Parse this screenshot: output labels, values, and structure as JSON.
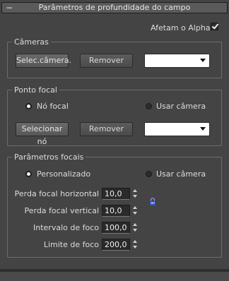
{
  "rollout": {
    "collapse_symbol": "−",
    "title": "Parâmetros de profundidade do campo"
  },
  "affect_alpha": {
    "label": "Afetam o Alpha",
    "checked": true
  },
  "cameras": {
    "title": "Câmeras",
    "select_button": "Selec.câmera.",
    "remove_button": "Remover",
    "dropdown_value": ""
  },
  "focal_point": {
    "title": "Ponto focal",
    "radio_focal_node": "Nó focal",
    "radio_use_camera": "Usar câmera",
    "selected": "focal_node",
    "select_node_button": "Selecionar nó",
    "remove_button": "Remover",
    "dropdown_value": ""
  },
  "focal_params": {
    "title": "Parâmetros focais",
    "radio_custom": "Personalizado",
    "radio_use_camera": "Usar câmera",
    "selected": "custom",
    "horizontal_loss_label": "Perda focal horizontal",
    "horizontal_loss_value": "10,0",
    "vertical_loss_label": "Perda focal vertical",
    "vertical_loss_value": "10,0",
    "focus_interval_label": "Intervalo de foco",
    "focus_interval_value": "100,0",
    "focus_limit_label": "Limite de foco",
    "focus_limit_value": "200,0"
  },
  "icons": {
    "lock": "lock-icon",
    "checkmark": "checkmark-icon",
    "dropdown_arrow": "chevron-down-icon"
  },
  "colors": {
    "panel_bg": "#444444",
    "header_bg": "#5a5a5a",
    "field_bg": "#2a2a2a",
    "text": "#dcdcdc",
    "lock_blue": "#4a63c8"
  }
}
